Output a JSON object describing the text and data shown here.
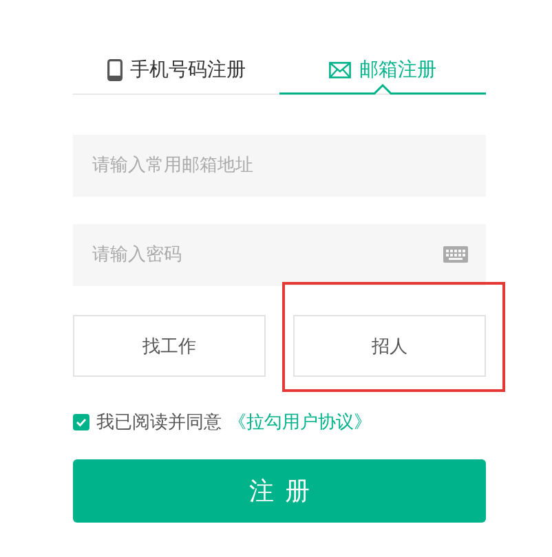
{
  "tabs": [
    {
      "label": "手机号码注册",
      "kind": "phone",
      "selected": false
    },
    {
      "label": "邮箱注册",
      "kind": "email",
      "selected": true
    }
  ],
  "fields": [
    {
      "placeholder": "请输入常用邮箱地址",
      "kind": "text"
    },
    {
      "placeholder": "请输入密码",
      "kind": "password"
    }
  ],
  "roles": [
    {
      "label": "找工作",
      "selected": false,
      "highlighted": false
    },
    {
      "label": "招人",
      "selected": false,
      "highlighted": true
    }
  ],
  "agreement": {
    "checked": true,
    "text": "我已阅读并同意",
    "link": "《拉勾用户协议》"
  },
  "submit": {
    "label": "注册"
  }
}
